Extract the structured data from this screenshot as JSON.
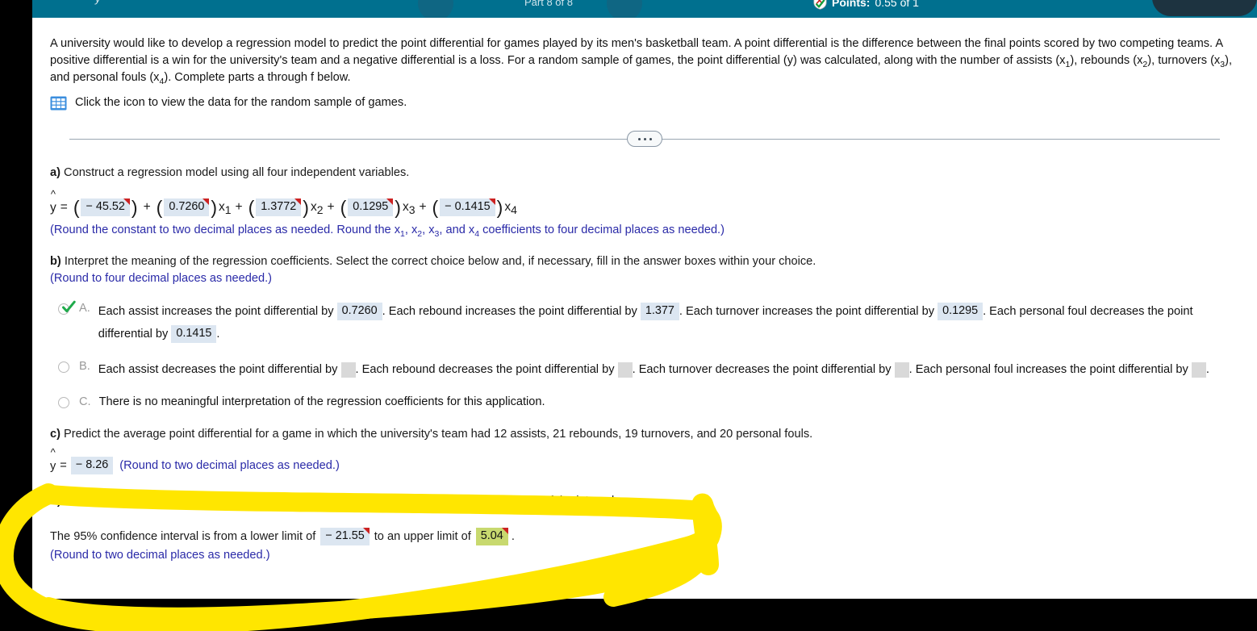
{
  "header": {
    "part_indicator": "Part 8 of 8",
    "points_label": "Points:",
    "points_value": "0.55 of 1",
    "prev_icon": "chevron-left-icon",
    "next_icon": "chevron-right-icon",
    "status_icon": "partial-credit-shield-icon",
    "bar_color": "#00708f"
  },
  "prompt": {
    "text_1": "A university would like to develop a regression model to predict the point differential for games played by its men's basketball team. A point differential is the difference between the final points scored by two competing teams. A positive differential is a win for the university's team and a negative differential is a loss. For a random sample of games, the point differential (y) was calculated, along with the number of assists (x",
    "sub_1": "1",
    "text_2": "), rebounds (x",
    "sub_2": "2",
    "text_3": "), turnovers (x",
    "sub_3": "3",
    "text_4": "), and personal fouls (x",
    "sub_4": "4",
    "text_5": "). Complete parts a through f below.",
    "data_link": "Click the icon to view the data for the random sample of games.",
    "data_icon": "spreadsheet-icon"
  },
  "divider": {
    "dots": "..."
  },
  "part_a": {
    "label": "a)",
    "text": " Construct a regression model using all four independent variables.",
    "equation": {
      "lhs": "y",
      "eq": "=",
      "constant": "− 45.52",
      "plus": "+",
      "coef_x1": "0.7260",
      "var_x1": "x",
      "sub_x1": "1",
      "coef_x2": "1.3772",
      "var_x2": "x",
      "sub_x2": "2",
      "coef_x3": "0.1295",
      "var_x3": "x",
      "sub_x3": "3",
      "coef_x4": "− 0.1415",
      "var_x4": "x",
      "sub_x4": "4"
    },
    "rounding_note_1": "(Round the constant to two decimal places as needed. Round the x",
    "rounding_sub_1": "1",
    "rounding_note_2": ", x",
    "rounding_sub_2": "2",
    "rounding_note_3": ", x",
    "rounding_sub_3": "3",
    "rounding_note_4": ", and x",
    "rounding_sub_4": "4",
    "rounding_note_5": " coefficients to four decimal places as needed.)"
  },
  "part_b": {
    "label": "b)",
    "text": " Interpret the meaning of the regression coefficients. Select the correct choice below and, if necessary, fill in the answer boxes within your choice.",
    "rounding_note": "(Round to four decimal places as needed.)",
    "choices": [
      {
        "letter": "A.",
        "selected": true,
        "seg_1": "Each assist increases the point differential by",
        "val_1": "0.7260",
        "seg_2": ". Each rebound increases the point differential by",
        "val_2": "1.377",
        "seg_3": ". Each turnover increases the point differential by",
        "val_3": "0.1295",
        "seg_4": ". Each personal foul decreases the point differential by",
        "val_4": "0.1415",
        "seg_5": "."
      },
      {
        "letter": "B.",
        "selected": false,
        "seg_1": "Each assist decreases the point differential by",
        "val_1": "",
        "seg_2": ". Each rebound decreases the point differential by",
        "val_2": "",
        "seg_3": ". Each turnover decreases the point differential by",
        "val_3": "",
        "seg_4": ". Each personal foul increases the point differential by",
        "val_4": "",
        "seg_5": "."
      },
      {
        "letter": "C.",
        "selected": false,
        "seg_1": "There is no meaningful interpretation of the regression coefficients for this application."
      }
    ]
  },
  "part_c": {
    "label": "c)",
    "text": " Predict the average point differential for a game in which the university's team had 12 assists, 21 rebounds, 19 turnovers, and 20 personal fouls.",
    "answer_lhs": "y",
    "answer_eq": "=",
    "answer_value": "− 8.26",
    "rounding_note": "(Round to two decimal places as needed.)"
  },
  "part_d": {
    "label": "d)",
    "text": " Construct a 95% confidence interval for the game described in part c. Interpret the meaning of the interval.",
    "sentence_1": "The 95% confidence interval is from a lower limit of",
    "lower_limit": "− 21.55",
    "sentence_2": "to an upper limit of",
    "upper_limit": "5.04",
    "sentence_3": ".",
    "rounding_note": "(Round to two decimal places as needed.)"
  },
  "annotation": {
    "type": "highlighter-loop",
    "color": "#ffe600",
    "description": "hand-drawn yellow highlighter loop circling part d"
  }
}
